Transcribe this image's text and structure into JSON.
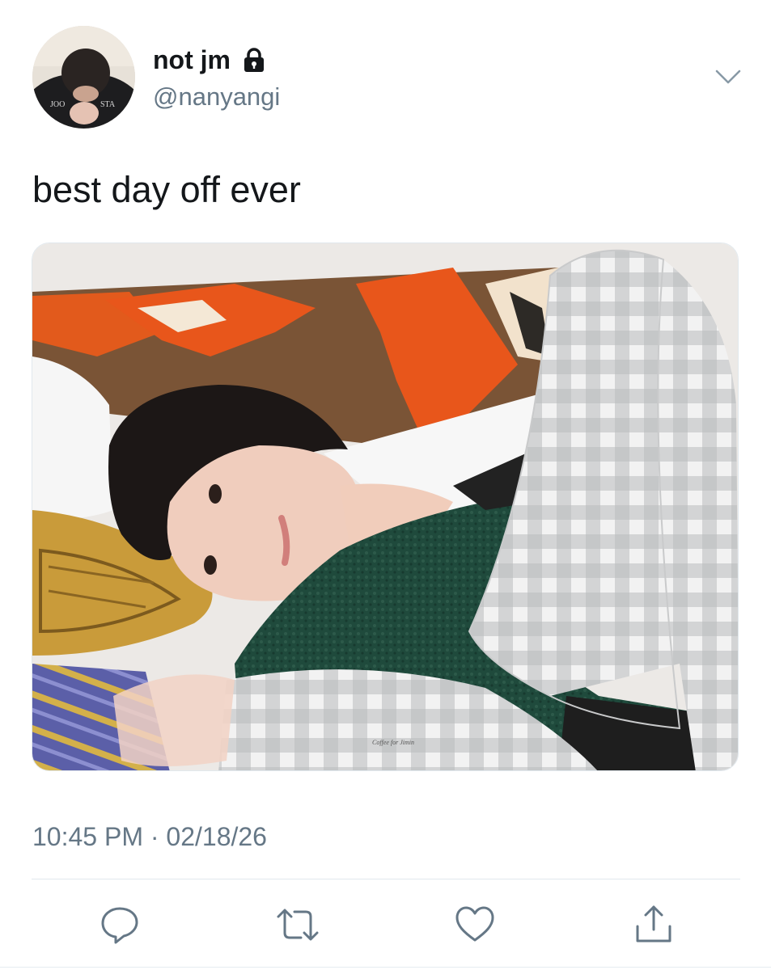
{
  "author": {
    "display_name": "not jm",
    "handle": "@nanyangi",
    "protected_icon": "lock-icon",
    "avatar_icon": "avatar-photo"
  },
  "tweet": {
    "text": "best day off ever",
    "media_icon": "photo",
    "media_watermark": "Coffee for Jimin"
  },
  "meta": {
    "time": "10:45 PM",
    "separator": "·",
    "date": "02/18/26"
  },
  "actions": [
    {
      "icon": "reply-icon"
    },
    {
      "icon": "retweet-icon"
    },
    {
      "icon": "like-icon"
    },
    {
      "icon": "share-icon"
    }
  ],
  "menu_icon": "chevron-down-icon",
  "colors": {
    "text_primary": "#14171a",
    "text_secondary": "#657786",
    "icon_gray": "#657786",
    "divider": "#e1e8ed"
  }
}
